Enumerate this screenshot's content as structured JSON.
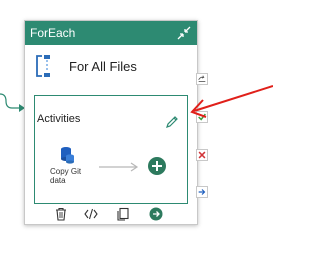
{
  "card": {
    "title": "ForEach",
    "activity_name": "For All Files",
    "header_color": "#2d8a72"
  },
  "activities": {
    "label": "Activities",
    "items": [
      {
        "name_line1": "Copy Git",
        "name_line2": "data",
        "icon": "git-icon"
      }
    ]
  },
  "footer": {
    "icons": [
      "delete-icon",
      "code-icon",
      "copy-icon",
      "arrow-right-circle-icon"
    ]
  },
  "status_icons": [
    "skip-icon",
    "success-icon",
    "failure-icon",
    "completion-icon"
  ],
  "colors": {
    "accent": "#2d8a72",
    "success": "#3c9a3c",
    "failure": "#d13438",
    "completion": "#1f5fbf",
    "annotation": "#e0201a"
  }
}
